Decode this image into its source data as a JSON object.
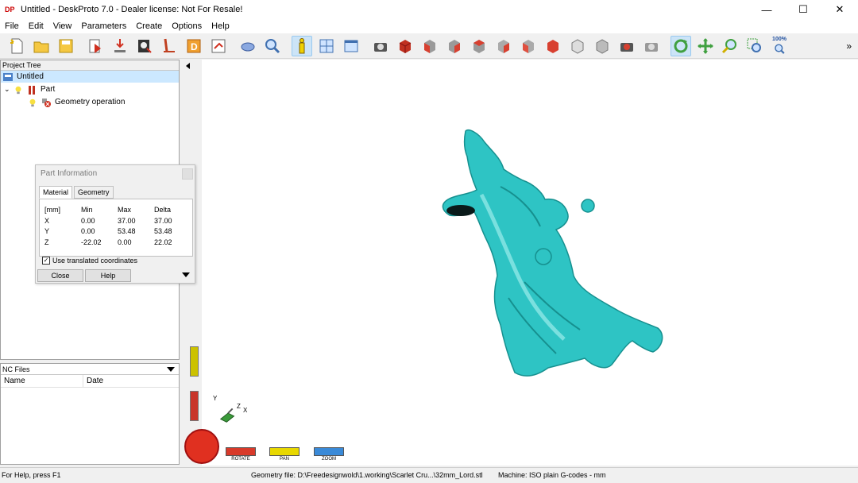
{
  "window": {
    "title": "Untitled - DeskProto 7.0 - Dealer license: Not For Resale!",
    "logo": "DP",
    "minimize": "—",
    "maximize": "☐",
    "close": "✕"
  },
  "menu": [
    "File",
    "Edit",
    "View",
    "Parameters",
    "Create",
    "Options",
    "Help"
  ],
  "toolbar": {
    "zoom_percent": "100%",
    "overflow": "»"
  },
  "project_tree": {
    "header": "Project Tree",
    "items": [
      {
        "label": "Untitled"
      },
      {
        "label": "Part"
      },
      {
        "label": "Geometry operation"
      }
    ]
  },
  "nc_files": {
    "header": "NC Files",
    "columns": [
      "Name",
      "Date"
    ]
  },
  "part_info": {
    "title": "Part Information",
    "tabs": [
      "Material",
      "Geometry"
    ],
    "header": [
      "[mm]",
      "Min",
      "Max",
      "Delta"
    ],
    "rows": [
      [
        "X",
        "0.00",
        "37.00",
        "37.00"
      ],
      [
        "Y",
        "0.00",
        "53.48",
        "53.48"
      ],
      [
        "Z",
        "-22.02",
        "0.00",
        "22.02"
      ]
    ],
    "checkbox_label": "Use translated coordinates",
    "checkbox_checked": true,
    "close_label": "Close",
    "help_label": "Help"
  },
  "viewport": {
    "sliders": [
      "ROTATE",
      "PAN",
      "ZOOM"
    ],
    "axis_labels": {
      "y": "Y",
      "z": "Z",
      "x": "X"
    },
    "model_color": "#2ec4c4"
  },
  "status": {
    "help": "For Help, press F1",
    "geometry_file": "Geometry file: D:\\Freedesignwold\\1.working\\Scarlet Cru...\\32mm_Lord.stl",
    "machine": "Machine: ISO plain G-codes - mm"
  }
}
